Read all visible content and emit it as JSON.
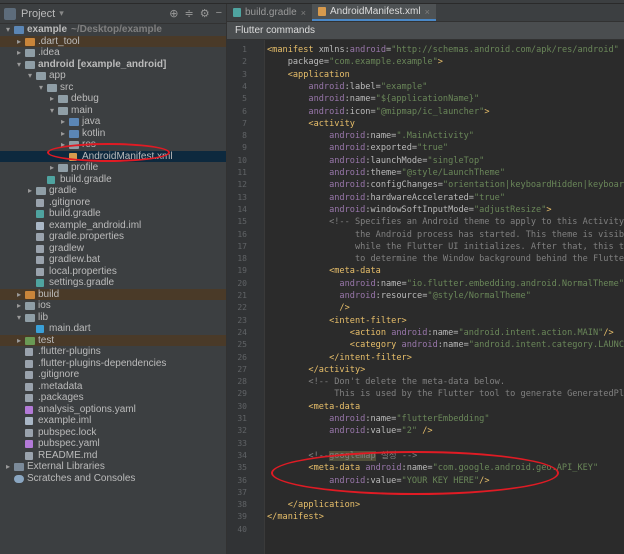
{
  "project_panel": {
    "title": "Project",
    "tree": [
      {
        "label": "example",
        "sub": "~/Desktop/example",
        "depth": 0,
        "arrow": "▾",
        "icon": "folder-blue",
        "bold": true
      },
      {
        "label": ".dart_tool",
        "depth": 1,
        "arrow": "▸",
        "icon": "folder-orange",
        "highlight": "exc-hl"
      },
      {
        "label": ".idea",
        "depth": 1,
        "arrow": "▸",
        "icon": "folder"
      },
      {
        "label": "android [example_android]",
        "depth": 1,
        "arrow": "▾",
        "icon": "folder",
        "bold": true
      },
      {
        "label": "app",
        "depth": 2,
        "arrow": "▾",
        "icon": "folder"
      },
      {
        "label": "src",
        "depth": 3,
        "arrow": "▾",
        "icon": "folder"
      },
      {
        "label": "debug",
        "depth": 4,
        "arrow": "▸",
        "icon": "folder"
      },
      {
        "label": "main",
        "depth": 4,
        "arrow": "▾",
        "icon": "folder"
      },
      {
        "label": "java",
        "depth": 5,
        "arrow": "▸",
        "icon": "folder-blue"
      },
      {
        "label": "kotlin",
        "depth": 5,
        "arrow": "▸",
        "icon": "folder-blue"
      },
      {
        "label": "res",
        "depth": 5,
        "arrow": "▸",
        "icon": "folder"
      },
      {
        "label": "AndroidManifest.xml",
        "depth": 5,
        "arrow": "",
        "icon": "file-xml",
        "selected": true
      },
      {
        "label": "profile",
        "depth": 4,
        "arrow": "▸",
        "icon": "folder"
      },
      {
        "label": "build.gradle",
        "depth": 3,
        "arrow": "",
        "icon": "file-gradle"
      },
      {
        "label": "gradle",
        "depth": 2,
        "arrow": "▸",
        "icon": "folder"
      },
      {
        "label": ".gitignore",
        "depth": 2,
        "arrow": "",
        "icon": "file"
      },
      {
        "label": "build.gradle",
        "depth": 2,
        "arrow": "",
        "icon": "file-gradle"
      },
      {
        "label": "example_android.iml",
        "depth": 2,
        "arrow": "",
        "icon": "file-iml"
      },
      {
        "label": "gradle.properties",
        "depth": 2,
        "arrow": "",
        "icon": "file"
      },
      {
        "label": "gradlew",
        "depth": 2,
        "arrow": "",
        "icon": "file"
      },
      {
        "label": "gradlew.bat",
        "depth": 2,
        "arrow": "",
        "icon": "file"
      },
      {
        "label": "local.properties",
        "depth": 2,
        "arrow": "",
        "icon": "file"
      },
      {
        "label": "settings.gradle",
        "depth": 2,
        "arrow": "",
        "icon": "file-gradle"
      },
      {
        "label": "build",
        "depth": 1,
        "arrow": "▸",
        "icon": "folder-orange",
        "highlight": "exc-hl"
      },
      {
        "label": "ios",
        "depth": 1,
        "arrow": "▸",
        "icon": "folder"
      },
      {
        "label": "lib",
        "depth": 1,
        "arrow": "▾",
        "icon": "folder"
      },
      {
        "label": "main.dart",
        "depth": 2,
        "arrow": "",
        "icon": "file-dart"
      },
      {
        "label": "test",
        "depth": 1,
        "arrow": "▸",
        "icon": "folder-green",
        "highlight": "exc-hl"
      },
      {
        "label": ".flutter-plugins",
        "depth": 1,
        "arrow": "",
        "icon": "file"
      },
      {
        "label": ".flutter-plugins-dependencies",
        "depth": 1,
        "arrow": "",
        "icon": "file"
      },
      {
        "label": ".gitignore",
        "depth": 1,
        "arrow": "",
        "icon": "file"
      },
      {
        "label": ".metadata",
        "depth": 1,
        "arrow": "",
        "icon": "file"
      },
      {
        "label": ".packages",
        "depth": 1,
        "arrow": "",
        "icon": "file"
      },
      {
        "label": "analysis_options.yaml",
        "depth": 1,
        "arrow": "",
        "icon": "file-yaml"
      },
      {
        "label": "example.iml",
        "depth": 1,
        "arrow": "",
        "icon": "file-iml"
      },
      {
        "label": "pubspec.lock",
        "depth": 1,
        "arrow": "",
        "icon": "file"
      },
      {
        "label": "pubspec.yaml",
        "depth": 1,
        "arrow": "",
        "icon": "file-yaml"
      },
      {
        "label": "README.md",
        "depth": 1,
        "arrow": "",
        "icon": "file"
      },
      {
        "label": "External Libraries",
        "depth": 0,
        "arrow": "▸",
        "icon": "lib"
      },
      {
        "label": "Scratches and Consoles",
        "depth": 0,
        "arrow": "",
        "icon": "scratch"
      }
    ]
  },
  "editor": {
    "tabs": [
      {
        "label": "build.gradle",
        "icon": "gradle",
        "active": false
      },
      {
        "label": "AndroidManifest.xml",
        "icon": "xml",
        "active": true
      }
    ],
    "notification": "Flutter commands",
    "lines": [
      [
        [
          "t-tag",
          "<manifest"
        ],
        [
          "t-attr",
          " xmlns:"
        ],
        [
          "t-ns",
          "android"
        ],
        [
          "t-attr",
          "="
        ],
        [
          "t-val",
          "\"http://schemas.android.com/apk/res/android\""
        ]
      ],
      [
        [
          "t-attr",
          "    package="
        ],
        [
          "t-val",
          "\"com.example.example\""
        ],
        [
          "t-tag",
          ">"
        ]
      ],
      [
        [
          "t-tag",
          "    <application"
        ]
      ],
      [
        [
          "t-ns",
          "        android"
        ],
        [
          "t-attr",
          ":label="
        ],
        [
          "t-val",
          "\"example\""
        ]
      ],
      [
        [
          "t-ns",
          "        android"
        ],
        [
          "t-attr",
          ":name="
        ],
        [
          "t-val",
          "\"${applicationName}\""
        ]
      ],
      [
        [
          "t-ns",
          "        android"
        ],
        [
          "t-attr",
          ":icon="
        ],
        [
          "t-val",
          "\"@mipmap/ic_launcher\""
        ],
        [
          "t-tag",
          ">"
        ]
      ],
      [
        [
          "t-tag",
          "        <activity"
        ]
      ],
      [
        [
          "t-ns",
          "            android"
        ],
        [
          "t-attr",
          ":name="
        ],
        [
          "t-val",
          "\".MainActivity\""
        ]
      ],
      [
        [
          "t-ns",
          "            android"
        ],
        [
          "t-attr",
          ":exported="
        ],
        [
          "t-val",
          "\"true\""
        ]
      ],
      [
        [
          "t-ns",
          "            android"
        ],
        [
          "t-attr",
          ":launchMode="
        ],
        [
          "t-val",
          "\"singleTop\""
        ]
      ],
      [
        [
          "t-ns",
          "            android"
        ],
        [
          "t-attr",
          ":theme="
        ],
        [
          "t-val",
          "\"@style/LaunchTheme\""
        ]
      ],
      [
        [
          "t-ns",
          "            android"
        ],
        [
          "t-attr",
          ":configChanges="
        ],
        [
          "t-val",
          "\"orientation|keyboardHidden|keyboard|screenSize"
        ]
      ],
      [
        [
          "t-ns",
          "            android"
        ],
        [
          "t-attr",
          ":hardwareAccelerated="
        ],
        [
          "t-val",
          "\"true\""
        ]
      ],
      [
        [
          "t-ns",
          "            android"
        ],
        [
          "t-attr",
          ":windowSoftInputMode="
        ],
        [
          "t-val",
          "\"adjustResize\""
        ],
        [
          "t-tag",
          ">"
        ]
      ],
      [
        [
          "t-com",
          "            <!-- Specifies an Android theme to apply to this Activity as soon as"
        ]
      ],
      [
        [
          "t-com",
          "                 the Android process has started. This theme is visible to the use"
        ]
      ],
      [
        [
          "t-com",
          "                 while the Flutter UI initializes. After that, this theme continue"
        ]
      ],
      [
        [
          "t-com",
          "                 to determine the Window background behind the Flutter UI. -->"
        ]
      ],
      [
        [
          "t-tag",
          "            <meta-data"
        ]
      ],
      [
        [
          "t-ns",
          "              android"
        ],
        [
          "t-attr",
          ":name="
        ],
        [
          "t-val",
          "\"io.flutter.embedding.android.NormalTheme\""
        ]
      ],
      [
        [
          "t-ns",
          "              android"
        ],
        [
          "t-attr",
          ":resource="
        ],
        [
          "t-val",
          "\"@style/NormalTheme\""
        ]
      ],
      [
        [
          "t-tag",
          "              />"
        ]
      ],
      [
        [
          "t-tag",
          "            <intent-filter>"
        ]
      ],
      [
        [
          "t-tag",
          "                <action "
        ],
        [
          "t-ns",
          "android"
        ],
        [
          "t-attr",
          ":name="
        ],
        [
          "t-val",
          "\"android.intent.action.MAIN\""
        ],
        [
          "t-tag",
          "/>"
        ]
      ],
      [
        [
          "t-tag",
          "                <category "
        ],
        [
          "t-ns",
          "android"
        ],
        [
          "t-attr",
          ":name="
        ],
        [
          "t-val",
          "\"android.intent.category.LAUNCHER\""
        ],
        [
          "t-tag",
          "/>"
        ]
      ],
      [
        [
          "t-tag",
          "            </intent-filter>"
        ]
      ],
      [
        [
          "t-tag",
          "        </activity>"
        ]
      ],
      [
        [
          "t-com",
          "        <!-- Don't delete the meta-data below."
        ]
      ],
      [
        [
          "t-com",
          "             This is used by the Flutter tool to generate GeneratedPluginRegistran"
        ]
      ],
      [
        [
          "t-tag",
          "        <meta-data"
        ]
      ],
      [
        [
          "t-ns",
          "            android"
        ],
        [
          "t-attr",
          ":name="
        ],
        [
          "t-val",
          "\"flutterEmbedding\""
        ]
      ],
      [
        [
          "t-ns",
          "            android"
        ],
        [
          "t-attr",
          ":value="
        ],
        [
          "t-val",
          "\"2\""
        ],
        [
          "t-tag",
          " />"
        ]
      ],
      [
        [
          "t-attr",
          ""
        ]
      ],
      [
        [
          "t-com",
          "        <!--"
        ],
        [
          "t-com t-hlbox",
          "googlemap"
        ],
        [
          "t-com",
          " 설정 -->"
        ]
      ],
      [
        [
          "t-tag",
          "        <meta-data "
        ],
        [
          "t-ns",
          "android"
        ],
        [
          "t-attr",
          ":name="
        ],
        [
          "t-val",
          "\"com.google.android.geo.API_KEY\""
        ]
      ],
      [
        [
          "t-ns",
          "            android"
        ],
        [
          "t-attr",
          ":value="
        ],
        [
          "t-val",
          "\"YOUR KEY HERE\""
        ],
        [
          "t-tag",
          "/>"
        ]
      ],
      [
        [
          "t-attr",
          ""
        ]
      ],
      [
        [
          "t-tag",
          "    </application>"
        ]
      ],
      [
        [
          "t-tag",
          "</manifest>"
        ]
      ],
      [
        [
          "t-attr",
          ""
        ]
      ]
    ],
    "line_numbers": [
      "1",
      "2",
      "3",
      "4",
      "5",
      "6",
      "7",
      "8",
      "9",
      "10",
      "11",
      "12",
      "13",
      "14",
      "15",
      "16",
      "17",
      "18",
      "19",
      "20",
      "21",
      "22",
      "23",
      "24",
      "25",
      "26",
      "27",
      "28",
      "29",
      "30",
      "31",
      "32",
      "33",
      "34",
      "35",
      "36",
      "37",
      "38",
      "39",
      "40"
    ]
  }
}
